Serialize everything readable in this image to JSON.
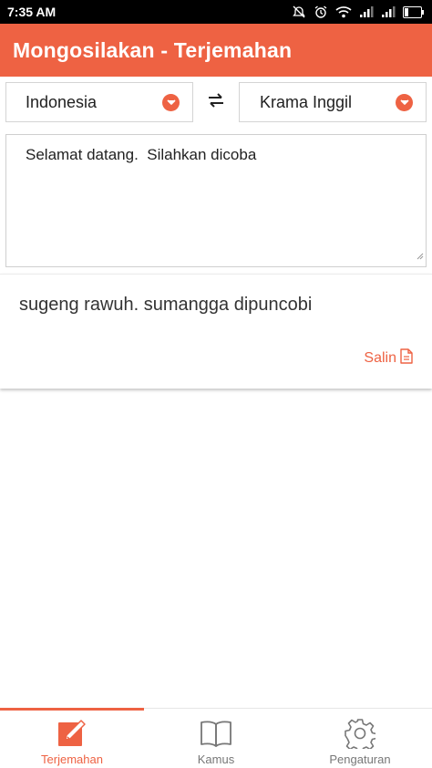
{
  "status": {
    "time": "7:35 AM"
  },
  "app": {
    "title": "Mongosilakan - Terjemahan"
  },
  "languages": {
    "source": "Indonesia",
    "target": "Krama Inggil"
  },
  "input": {
    "text": "Selamat datang.  Silahkan dicoba"
  },
  "result": {
    "text": "sugeng rawuh. sumangga dipuncobi",
    "copy_label": "Salin"
  },
  "nav": {
    "items": [
      {
        "label": "Terjemahan",
        "icon": "edit-icon",
        "active": true
      },
      {
        "label": "Kamus",
        "icon": "book-icon",
        "active": false
      },
      {
        "label": "Pengaturan",
        "icon": "gear-icon",
        "active": false
      }
    ]
  },
  "colors": {
    "accent": "#EE6243",
    "status_bar": "#000000",
    "inactive_nav": "#777777"
  }
}
